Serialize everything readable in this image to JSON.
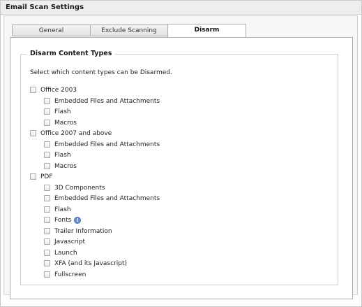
{
  "window": {
    "title": "Email Scan Settings"
  },
  "tabs": [
    {
      "label": "General"
    },
    {
      "label": "Exclude Scanning"
    },
    {
      "label": "Disarm"
    }
  ],
  "active_tab": "Disarm",
  "disarm": {
    "legend": "Disarm Content Types",
    "description": "Select which content types can be Disarmed.",
    "groups": [
      {
        "label": "Office 2003",
        "checked": false,
        "items": [
          {
            "label": "Embedded Files and Attachments",
            "checked": false
          },
          {
            "label": "Flash",
            "checked": false
          },
          {
            "label": "Macros",
            "checked": false
          }
        ]
      },
      {
        "label": "Office 2007 and above",
        "checked": false,
        "items": [
          {
            "label": "Embedded Files and Attachments",
            "checked": false
          },
          {
            "label": "Flash",
            "checked": false
          },
          {
            "label": "Macros",
            "checked": false
          }
        ]
      },
      {
        "label": "PDF",
        "checked": false,
        "items": [
          {
            "label": "3D Components",
            "checked": false
          },
          {
            "label": "Embedded Files and Attachments",
            "checked": false
          },
          {
            "label": "Flash",
            "checked": false
          },
          {
            "label": "Fonts",
            "checked": false,
            "info_icon": "info-icon"
          },
          {
            "label": "Trailer Information",
            "checked": false
          },
          {
            "label": "Javascript",
            "checked": false
          },
          {
            "label": "Launch",
            "checked": false
          },
          {
            "label": "XFA (and its Javascript)",
            "checked": false
          },
          {
            "label": "Fullscreen",
            "checked": false
          }
        ]
      }
    ]
  },
  "colors": {
    "info_icon": "#6f8fc8",
    "border": "#adadad"
  }
}
